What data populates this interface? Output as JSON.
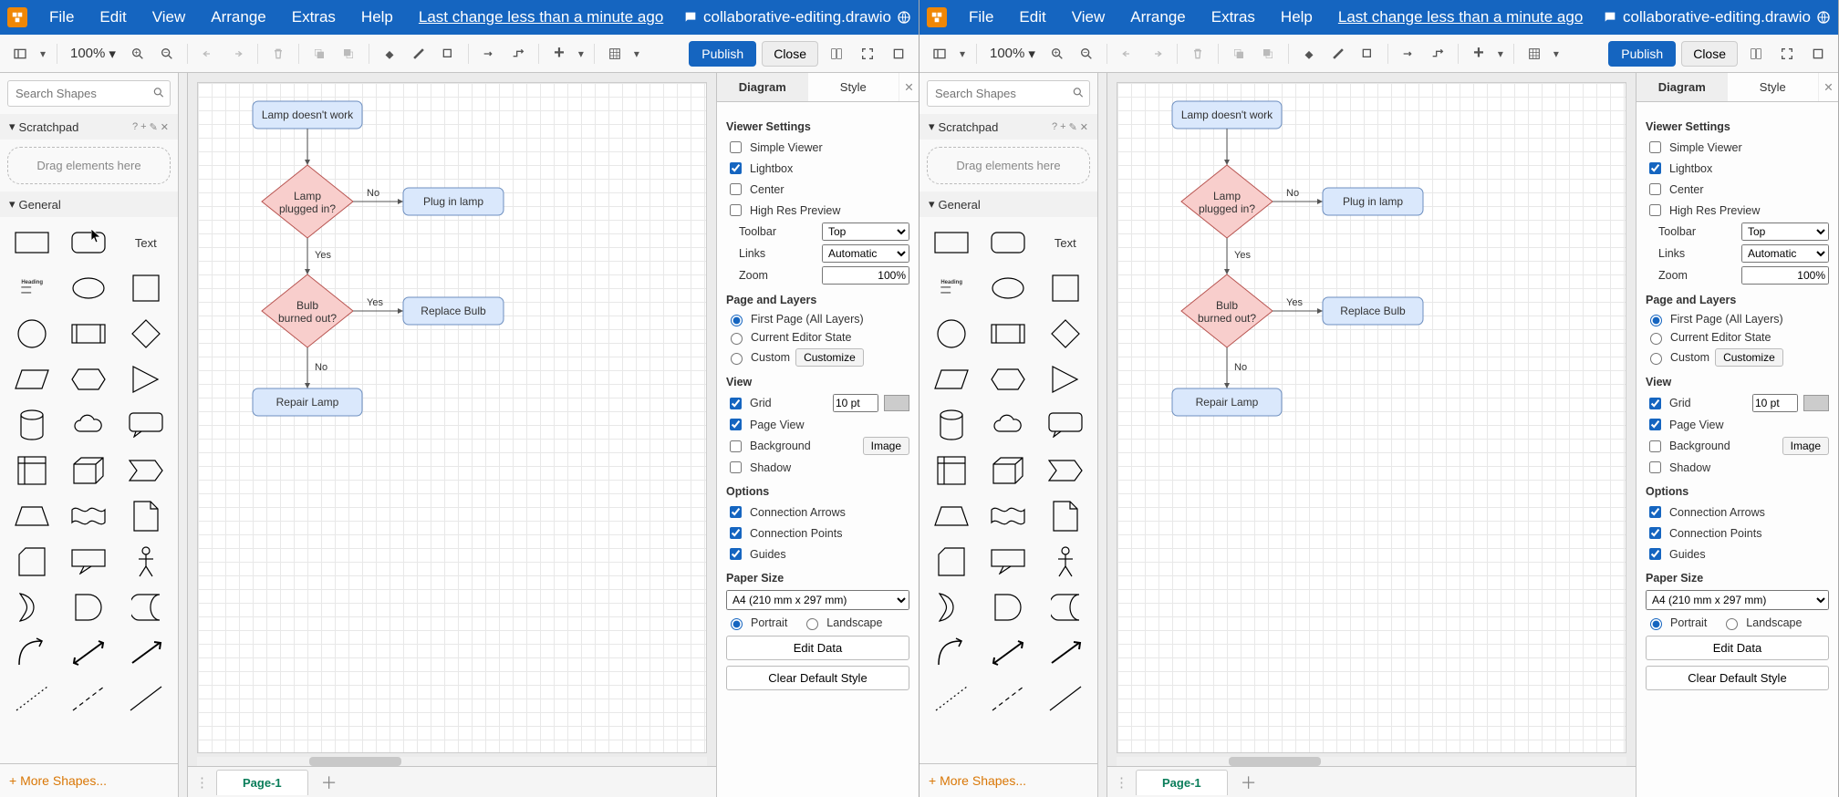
{
  "menubar": {
    "items": [
      "File",
      "Edit",
      "View",
      "Arrange",
      "Extras",
      "Help"
    ],
    "lastChange": "Last change less than a minute ago",
    "filename": "collaborative-editing.drawio"
  },
  "toolbar": {
    "zoom": "100%",
    "publish": "Publish",
    "close": "Close"
  },
  "sidebar": {
    "searchPlaceholder": "Search Shapes",
    "scratchpad": "Scratchpad",
    "dragHint": "Drag elements here",
    "general": "General",
    "textLabel": "Text",
    "headingLabel": "Heading",
    "moreShapes": "+ More Shapes..."
  },
  "pages": {
    "page1": "Page-1"
  },
  "flow": {
    "start": "Lamp doesn't work",
    "d1a": "Lamp",
    "d1b": "plugged in?",
    "a1": "Plug in lamp",
    "d2a": "Bulb",
    "d2b": "burned out?",
    "a2": "Replace Bulb",
    "end": "Repair Lamp",
    "no": "No",
    "yes": "Yes"
  },
  "format": {
    "tabDiagram": "Diagram",
    "tabStyle": "Style",
    "viewerSettings": "Viewer Settings",
    "simpleViewer": "Simple Viewer",
    "lightbox": "Lightbox",
    "center": "Center",
    "highRes": "High Res Preview",
    "toolbarLbl": "Toolbar",
    "toolbarVal": "Top",
    "linksLbl": "Links",
    "linksVal": "Automatic",
    "zoomLbl": "Zoom",
    "zoomVal": "100%",
    "pageLayers": "Page and Layers",
    "firstPage": "First Page (All Layers)",
    "currentEditor": "Current Editor State",
    "custom": "Custom",
    "customize": "Customize",
    "view": "View",
    "grid": "Grid",
    "gridVal": "10 pt",
    "pageView": "Page View",
    "background": "Background",
    "image": "Image",
    "shadow": "Shadow",
    "options": "Options",
    "connArrows": "Connection Arrows",
    "connPoints": "Connection Points",
    "guides": "Guides",
    "paperSize": "Paper Size",
    "paperVal": "A4 (210 mm x 297 mm)",
    "portrait": "Portrait",
    "landscape": "Landscape",
    "editData": "Edit Data",
    "clearStyle": "Clear Default Style"
  }
}
